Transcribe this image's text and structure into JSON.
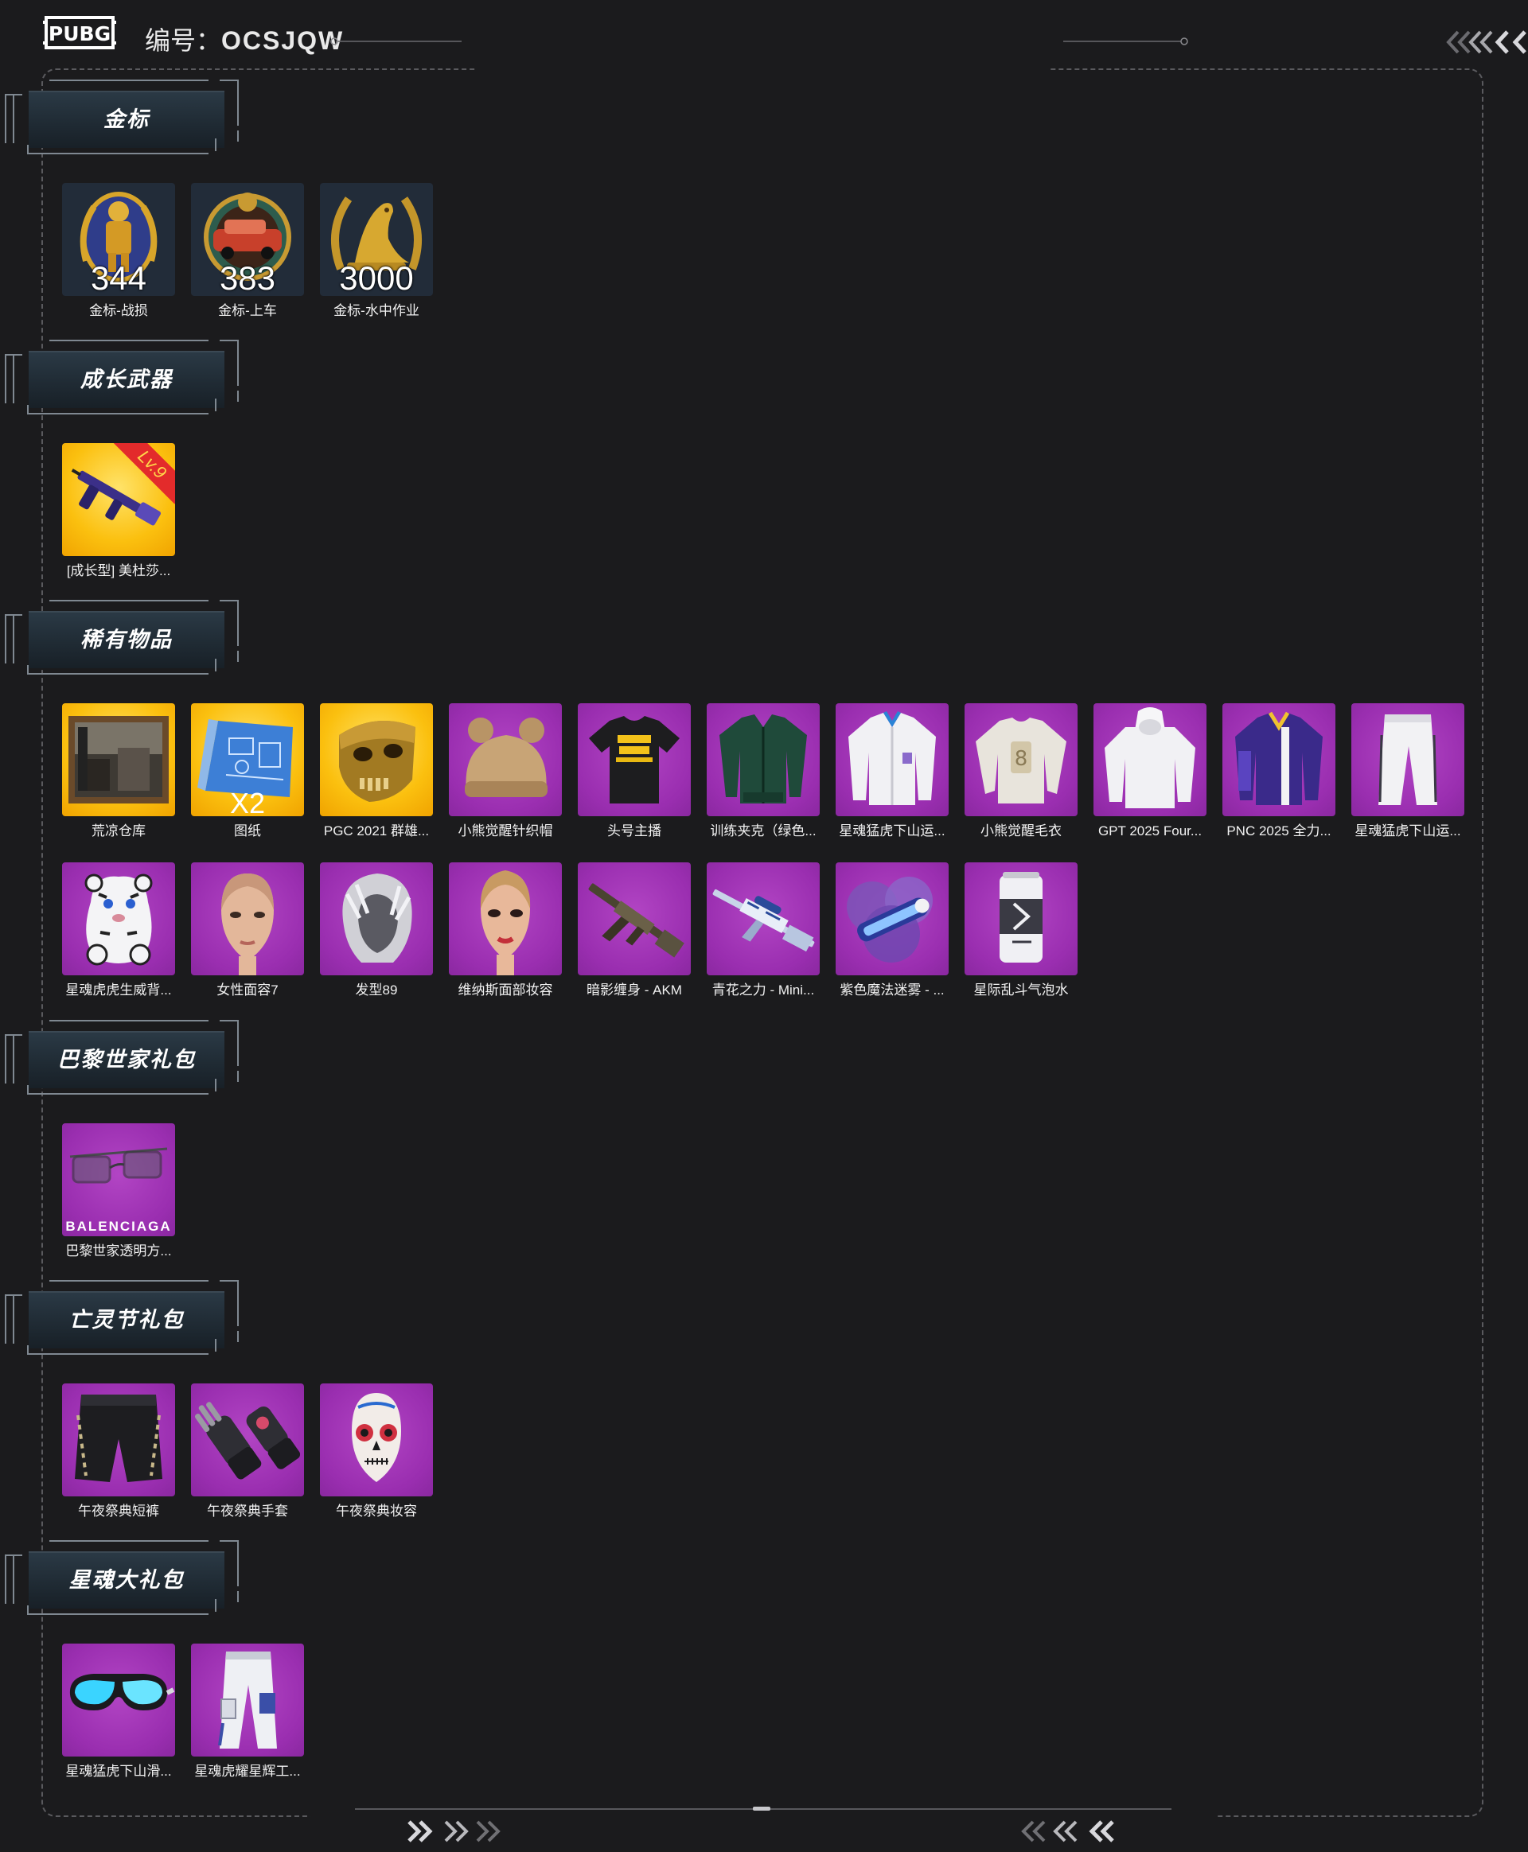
{
  "header": {
    "logo_text": "PUBG",
    "id_label": "编号：",
    "id_value": "OCSJQW"
  },
  "sections": [
    {
      "title": "金标",
      "items": [
        {
          "label": "金标-战损",
          "count": "344",
          "icon": "soldier-badge-icon",
          "bg": "badge"
        },
        {
          "label": "金标-上车",
          "count": "383",
          "icon": "car-badge-icon",
          "bg": "badge"
        },
        {
          "label": "金标-水中作业",
          "count": "3000",
          "icon": "seal-badge-icon",
          "bg": "badge"
        }
      ]
    },
    {
      "title": "成长武器",
      "items": [
        {
          "label": "[成长型] 美杜莎...",
          "tag": "Lv.9",
          "icon": "rifle-icon",
          "bg": "gold"
        }
      ]
    },
    {
      "title": "稀有物品",
      "items": [
        {
          "label": "荒凉仓库",
          "icon": "warehouse-picture-icon",
          "bg": "gold"
        },
        {
          "label": "图纸",
          "count": "X2",
          "icon": "blueprint-icon",
          "bg": "gold"
        },
        {
          "label": "PGC 2021 群雄...",
          "icon": "skull-mask-icon",
          "bg": "gold"
        },
        {
          "label": "小熊觉醒针织帽",
          "icon": "bear-hat-icon",
          "bg": "purple"
        },
        {
          "label": "头号主播",
          "icon": "tshirt-icon",
          "bg": "purple"
        },
        {
          "label": "训练夹克（绿色...",
          "icon": "green-jacket-icon",
          "bg": "purple"
        },
        {
          "label": "星魂猛虎下山运...",
          "icon": "white-jacket-icon",
          "bg": "purple"
        },
        {
          "label": "小熊觉醒毛衣",
          "icon": "sweater-icon",
          "bg": "purple"
        },
        {
          "label": "GPT 2025 Four...",
          "icon": "white-hoodie-icon",
          "bg": "purple"
        },
        {
          "label": "PNC 2025 全力...",
          "icon": "purple-jacket-icon",
          "bg": "purple"
        },
        {
          "label": "星魂猛虎下山运...",
          "icon": "white-pants-icon",
          "bg": "purple"
        },
        {
          "label": "星魂虎虎生威背...",
          "icon": "tiger-backpack-icon",
          "bg": "purple"
        },
        {
          "label": "女性面容7",
          "icon": "female-face-icon",
          "bg": "purple"
        },
        {
          "label": "发型89",
          "icon": "hairstyle-icon",
          "bg": "purple"
        },
        {
          "label": "维纳斯面部妆容",
          "icon": "makeup-face-icon",
          "bg": "purple"
        },
        {
          "label": "暗影缠身 - AKM",
          "icon": "akm-rifle-icon",
          "bg": "purple"
        },
        {
          "label": "青花之力 - Mini...",
          "icon": "sniper-rifle-icon",
          "bg": "purple"
        },
        {
          "label": "紫色魔法迷雾 - ...",
          "icon": "smoke-grenade-icon",
          "bg": "purple"
        },
        {
          "label": "星际乱斗气泡水",
          "icon": "soda-can-icon",
          "bg": "purple"
        }
      ]
    },
    {
      "title": "巴黎世家礼包",
      "items": [
        {
          "label": "巴黎世家透明方...",
          "brand": "BALENCIAGA",
          "icon": "glasses-icon",
          "bg": "purple"
        }
      ]
    },
    {
      "title": "亡灵节礼包",
      "items": [
        {
          "label": "午夜祭典短裤",
          "icon": "shorts-icon",
          "bg": "purple"
        },
        {
          "label": "午夜祭典手套",
          "icon": "gloves-icon",
          "bg": "purple"
        },
        {
          "label": "午夜祭典妆容",
          "icon": "skull-makeup-icon",
          "bg": "purple"
        }
      ]
    },
    {
      "title": "星魂大礼包",
      "items": [
        {
          "label": "星魂猛虎下山滑...",
          "icon": "ski-goggles-icon",
          "bg": "purple"
        },
        {
          "label": "星魂虎耀星辉工...",
          "icon": "cargo-pants-icon",
          "bg": "purple"
        }
      ]
    }
  ]
}
